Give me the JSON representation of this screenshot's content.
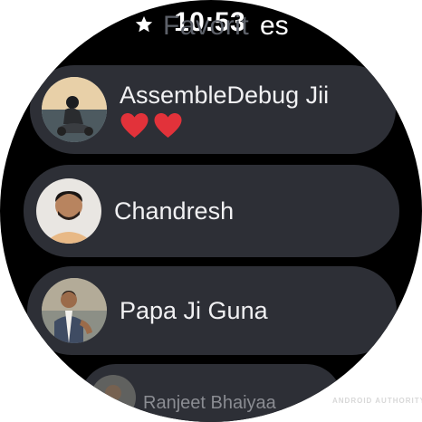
{
  "status_bar": {
    "time": "10:53",
    "title_tail": "es",
    "star_icon": "star-icon"
  },
  "contacts": [
    {
      "name": "AssembleDebug Jii",
      "emoji": "❤️❤️",
      "avatar_icon": "avatar-rider"
    },
    {
      "name": "Chandresh",
      "avatar_icon": "avatar-man"
    },
    {
      "name": "Papa Ji Guna",
      "avatar_icon": "avatar-man-traditional"
    },
    {
      "name": "Ranjeet Bhaiyaa",
      "avatar_icon": "avatar-person"
    }
  ],
  "watermark": "ANDROID AUTHORITY",
  "colors": {
    "card_bg": "#2d2f36",
    "screen_bg": "#000000",
    "text": "#f1f1f3",
    "heart": "#e2323a"
  }
}
